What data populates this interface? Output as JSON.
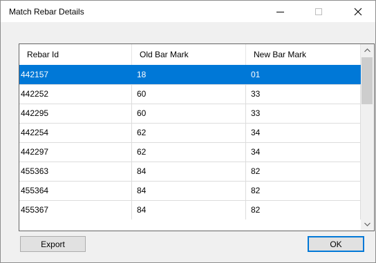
{
  "window": {
    "title": "Match Rebar Details"
  },
  "columns": [
    "Rebar Id",
    "Old Bar Mark",
    "New Bar Mark"
  ],
  "rows": [
    {
      "rebar_id": "442157",
      "old_mark": "18",
      "new_mark": "01",
      "selected": true
    },
    {
      "rebar_id": "442252",
      "old_mark": "60",
      "new_mark": "33"
    },
    {
      "rebar_id": "442295",
      "old_mark": "60",
      "new_mark": "33"
    },
    {
      "rebar_id": "442254",
      "old_mark": "62",
      "new_mark": "34"
    },
    {
      "rebar_id": "442297",
      "old_mark": "62",
      "new_mark": "34"
    },
    {
      "rebar_id": "455363",
      "old_mark": "84",
      "new_mark": "82"
    },
    {
      "rebar_id": "455364",
      "old_mark": "84",
      "new_mark": "82"
    },
    {
      "rebar_id": "455367",
      "old_mark": "84",
      "new_mark": "82"
    }
  ],
  "buttons": {
    "export": "Export",
    "ok": "OK"
  },
  "icons": {
    "minimize": "minimize-icon",
    "maximize": "maximize-icon",
    "close": "close-icon",
    "scroll_up": "chevron-up-icon",
    "scroll_down": "chevron-down-icon"
  },
  "colors": {
    "selection": "#0078d7",
    "default_button_border": "#0078d7"
  }
}
